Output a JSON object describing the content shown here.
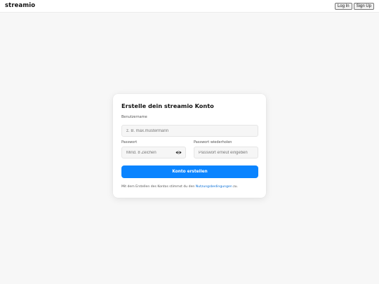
{
  "header": {
    "brand": "streamio",
    "login_label": "Log In",
    "signup_label": "Sign Up"
  },
  "form": {
    "title": "Erstelle dein streamio Konto",
    "username": {
      "label": "Benutzername",
      "placeholder": "z. B. max.mustermann"
    },
    "password": {
      "label": "Passwort",
      "placeholder": "Mind. 8 Zeichen",
      "toggle_icon": "eye-icon"
    },
    "password_repeat": {
      "label": "Passwort wiederholen",
      "placeholder": "Passwort erneut eingeben"
    },
    "submit_label": "Konto erstellen",
    "terms": {
      "prefix": "Mit dem Erstellen des Kontos stimmst du den ",
      "link": "Nutzungsbedingungen",
      "suffix": " zu."
    }
  },
  "colors": {
    "accent": "#0a84ff",
    "link": "#0a6fd6",
    "background": "#f7f7f7"
  }
}
